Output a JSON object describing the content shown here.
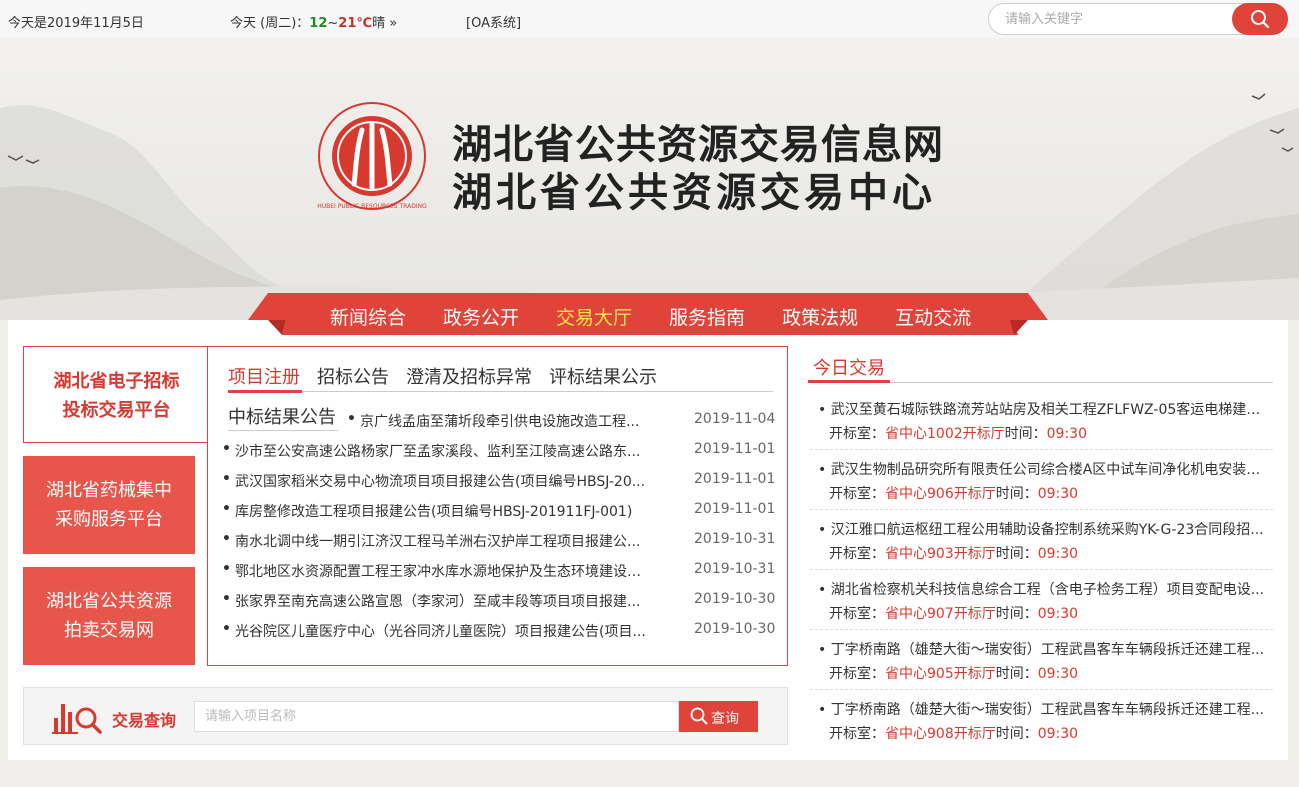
{
  "topbar": {
    "date": "今天是2019年11月5日",
    "weather_prefix": "今天 (周二)：",
    "weather_low": "12",
    "weather_sep": "~",
    "weather_high": "21℃",
    "weather_cond": "晴 »",
    "oa": "[OA系统]",
    "search_placeholder": "请输入关键字"
  },
  "banner": {
    "title1": "湖北省公共资源交易信息网",
    "title2": "湖北省公共资源交易中心",
    "logo_text": "HUBEI PUBLIC RESOURCES TRADING"
  },
  "nav": [
    "新闻综合",
    "政务公开",
    "交易大厅",
    "服务指南",
    "政策法规",
    "互动交流"
  ],
  "nav_active": "交易大厅",
  "platforms": [
    {
      "line1": "湖北省电子招标",
      "line2": "投标交易平台"
    },
    {
      "line1": "湖北省药械集中",
      "line2": "采购服务平台"
    },
    {
      "line1": "湖北省公共资源",
      "line2": "拍卖交易网"
    }
  ],
  "tabs": [
    "项目注册",
    "招标公告",
    "澄清及招标异常",
    "评标结果公示"
  ],
  "tab_second": "中标结果公告",
  "notices": [
    {
      "title": "京广线孟庙至蒲圻段牵引供电设施改造工程...",
      "date": "2019-11-04"
    },
    {
      "title": "沙市至公安高速公路杨家厂至孟家溪段、监利至江陵高速公路东...",
      "date": "2019-11-01"
    },
    {
      "title": "武汉国家稻米交易中心物流项目项目报建公告(项目编号HBSJ-20...",
      "date": "2019-11-01"
    },
    {
      "title": "库房整修改造工程项目报建公告(项目编号HBSJ-201911FJ-001)",
      "date": "2019-11-01"
    },
    {
      "title": "南水北调中线一期引江济汉工程马羊洲右汉护岸工程项目报建公...",
      "date": "2019-10-31"
    },
    {
      "title": "鄂北地区水资源配置工程王家冲水库水源地保护及生态环境建设E...",
      "date": "2019-10-31"
    },
    {
      "title": "张家界至南充高速公路宣恩（李家河）至咸丰段等项目项目报建...",
      "date": "2019-10-30"
    },
    {
      "title": "光谷院区儿童医疗中心（光谷同济儿童医院）项目报建公告(项目...",
      "date": "2019-10-30"
    }
  ],
  "query": {
    "label": "交易查询",
    "placeholder": "请输入项目名称",
    "button": "查询"
  },
  "today": {
    "title": "今日交易",
    "room_label": "开标室：",
    "time_label": "时间：",
    "items": [
      {
        "title": "武汉至黄石城际铁路流芳站站房及相关工程ZFLFWZ-05客运电梯建管...",
        "room": "省中心1002开标厅",
        "time": "09:30"
      },
      {
        "title": "武汉生物制品研究所有限责任公司综合楼A区中试车间净化机电安装工...",
        "room": "省中心906开标厅",
        "time": "09:30"
      },
      {
        "title": "汉江雅口航运枢纽工程公用辅助设备控制系统采购YK-G-23合同段招...",
        "room": "省中心903开标厅",
        "time": "09:30"
      },
      {
        "title": "湖北省检察机关科技信息综合工程（含电子检务工程）项目变配电设...",
        "room": "省中心907开标厅",
        "time": "09:30"
      },
      {
        "title": "丁字桥南路（雄楚大街～瑞安街）工程武昌客车车辆段拆迁还建工程...",
        "room": "省中心905开标厅",
        "time": "09:30"
      },
      {
        "title": "丁字桥南路（雄楚大街～瑞安街）工程武昌客车车辆段拆迁还建工程...",
        "room": "省中心908开标厅",
        "time": "09:30"
      }
    ]
  },
  "colors": {
    "accent": "#e0433a",
    "nav_active": "#ffe34a",
    "temp_low": "#1a8f1a"
  }
}
